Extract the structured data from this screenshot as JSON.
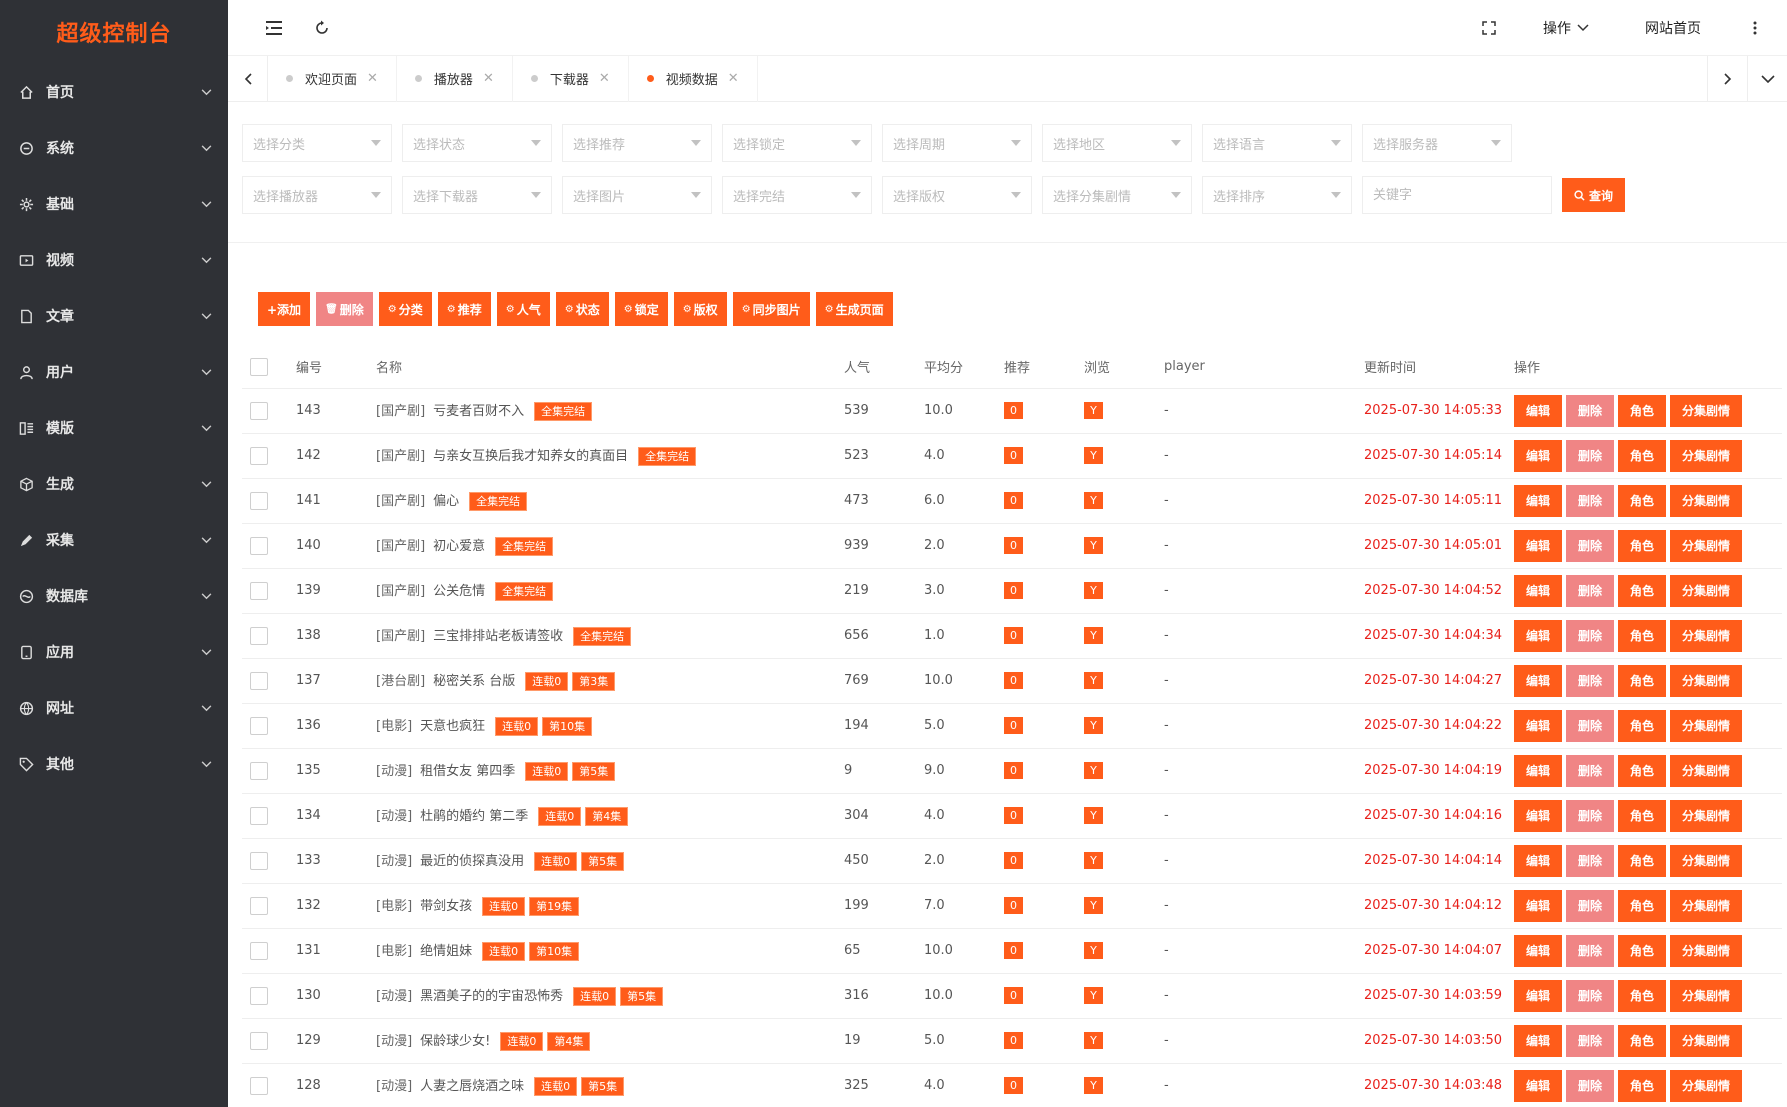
{
  "sidebar": {
    "title": "超级控制台",
    "items": [
      {
        "label": "首页",
        "icon": "home-icon"
      },
      {
        "label": "系统",
        "icon": "system-icon"
      },
      {
        "label": "基础",
        "icon": "gear-icon"
      },
      {
        "label": "视频",
        "icon": "video-icon"
      },
      {
        "label": "文章",
        "icon": "document-icon"
      },
      {
        "label": "用户",
        "icon": "user-icon"
      },
      {
        "label": "模版",
        "icon": "template-icon"
      },
      {
        "label": "生成",
        "icon": "cube-icon"
      },
      {
        "label": "采集",
        "icon": "pen-icon"
      },
      {
        "label": "数据库",
        "icon": "database-icon"
      },
      {
        "label": "应用",
        "icon": "tablet-icon"
      },
      {
        "label": "网址",
        "icon": "globe-icon"
      },
      {
        "label": "其他",
        "icon": "tag-icon"
      }
    ]
  },
  "header": {
    "operate": "操作",
    "site_home": "网站首页"
  },
  "tabs": [
    {
      "label": "欢迎页面",
      "active": false
    },
    {
      "label": "播放器",
      "active": false
    },
    {
      "label": "下载器",
      "active": false
    },
    {
      "label": "视频数据",
      "active": true
    }
  ],
  "filters": {
    "row1": [
      "选择分类",
      "选择状态",
      "选择推荐",
      "选择锁定",
      "选择周期",
      "选择地区",
      "选择语言",
      "选择服务器"
    ],
    "row2": [
      "选择播放器",
      "选择下载器",
      "选择图片",
      "选择完结",
      "选择版权",
      "选择分集剧情",
      "选择排序"
    ],
    "keyword_placeholder": "关键字",
    "query_label": "查询"
  },
  "toolbar": [
    {
      "label": "+添加",
      "style": "orange"
    },
    {
      "label": "删除",
      "style": "pink"
    },
    {
      "label": "分类",
      "style": "orange"
    },
    {
      "label": "推荐",
      "style": "orange"
    },
    {
      "label": "人气",
      "style": "orange"
    },
    {
      "label": "状态",
      "style": "orange"
    },
    {
      "label": "锁定",
      "style": "orange"
    },
    {
      "label": "版权",
      "style": "orange"
    },
    {
      "label": "同步图片",
      "style": "orange"
    },
    {
      "label": "生成页面",
      "style": "orange"
    }
  ],
  "table": {
    "columns": [
      "编号",
      "名称",
      "人气",
      "平均分",
      "推荐",
      "浏览",
      "player",
      "更新时间",
      "操作"
    ],
    "actions": [
      "编辑",
      "删除",
      "角色",
      "分集剧情"
    ],
    "rows": [
      {
        "id": "143",
        "cat": "[国产剧]",
        "name": "亏麦者百财不入",
        "tags": [
          "全集完结"
        ],
        "hits": "539",
        "score": "10.0",
        "rec": "0",
        "view": "Y",
        "player": "-",
        "time": "2025-07-30 14:05:33"
      },
      {
        "id": "142",
        "cat": "[国产剧]",
        "name": "与亲女互换后我才知养女的真面目",
        "tags": [
          "全集完结"
        ],
        "hits": "523",
        "score": "4.0",
        "rec": "0",
        "view": "Y",
        "player": "-",
        "time": "2025-07-30 14:05:14"
      },
      {
        "id": "141",
        "cat": "[国产剧]",
        "name": "偏心",
        "tags": [
          "全集完结"
        ],
        "hits": "473",
        "score": "6.0",
        "rec": "0",
        "view": "Y",
        "player": "-",
        "time": "2025-07-30 14:05:11"
      },
      {
        "id": "140",
        "cat": "[国产剧]",
        "name": "初心爱意",
        "tags": [
          "全集完结"
        ],
        "hits": "939",
        "score": "2.0",
        "rec": "0",
        "view": "Y",
        "player": "-",
        "time": "2025-07-30 14:05:01"
      },
      {
        "id": "139",
        "cat": "[国产剧]",
        "name": "公关危情",
        "tags": [
          "全集完结"
        ],
        "hits": "219",
        "score": "3.0",
        "rec": "0",
        "view": "Y",
        "player": "-",
        "time": "2025-07-30 14:04:52"
      },
      {
        "id": "138",
        "cat": "[国产剧]",
        "name": "三宝排排站老板请签收",
        "tags": [
          "全集完结"
        ],
        "hits": "656",
        "score": "1.0",
        "rec": "0",
        "view": "Y",
        "player": "-",
        "time": "2025-07-30 14:04:34"
      },
      {
        "id": "137",
        "cat": "[港台剧]",
        "name": "秘密关系 台版",
        "tags": [
          "连载0",
          "第3集"
        ],
        "hits": "769",
        "score": "10.0",
        "rec": "0",
        "view": "Y",
        "player": "-",
        "time": "2025-07-30 14:04:27"
      },
      {
        "id": "136",
        "cat": "[电影]",
        "name": "天意也疯狂",
        "tags": [
          "连载0",
          "第10集"
        ],
        "hits": "194",
        "score": "5.0",
        "rec": "0",
        "view": "Y",
        "player": "-",
        "time": "2025-07-30 14:04:22"
      },
      {
        "id": "135",
        "cat": "[动漫]",
        "name": "租借女友 第四季",
        "tags": [
          "连载0",
          "第5集"
        ],
        "hits": "9",
        "score": "9.0",
        "rec": "0",
        "view": "Y",
        "player": "-",
        "time": "2025-07-30 14:04:19"
      },
      {
        "id": "134",
        "cat": "[动漫]",
        "name": "杜鹃的婚约 第二季",
        "tags": [
          "连载0",
          "第4集"
        ],
        "hits": "304",
        "score": "4.0",
        "rec": "0",
        "view": "Y",
        "player": "-",
        "time": "2025-07-30 14:04:16"
      },
      {
        "id": "133",
        "cat": "[动漫]",
        "name": "最近的侦探真没用",
        "tags": [
          "连载0",
          "第5集"
        ],
        "hits": "450",
        "score": "2.0",
        "rec": "0",
        "view": "Y",
        "player": "-",
        "time": "2025-07-30 14:04:14"
      },
      {
        "id": "132",
        "cat": "[电影]",
        "name": "带剑女孩",
        "tags": [
          "连载0",
          "第19集"
        ],
        "hits": "199",
        "score": "7.0",
        "rec": "0",
        "view": "Y",
        "player": "-",
        "time": "2025-07-30 14:04:12"
      },
      {
        "id": "131",
        "cat": "[电影]",
        "name": "绝情姐妹",
        "tags": [
          "连载0",
          "第10集"
        ],
        "hits": "65",
        "score": "10.0",
        "rec": "0",
        "view": "Y",
        "player": "-",
        "time": "2025-07-30 14:04:07"
      },
      {
        "id": "130",
        "cat": "[动漫]",
        "name": "黑酒美子的的宇宙恐怖秀",
        "tags": [
          "连载0",
          "第5集"
        ],
        "hits": "316",
        "score": "10.0",
        "rec": "0",
        "view": "Y",
        "player": "-",
        "time": "2025-07-30 14:03:59"
      },
      {
        "id": "129",
        "cat": "[动漫]",
        "name": "保龄球少女!",
        "tags": [
          "连载0",
          "第4集"
        ],
        "hits": "19",
        "score": "5.0",
        "rec": "0",
        "view": "Y",
        "player": "-",
        "time": "2025-07-30 14:03:50"
      },
      {
        "id": "128",
        "cat": "[动漫]",
        "name": "人妻之唇烧酒之味",
        "tags": [
          "连载0",
          "第5集"
        ],
        "hits": "325",
        "score": "4.0",
        "rec": "0",
        "view": "Y",
        "player": "-",
        "time": "2025-07-30 14:03:48"
      }
    ]
  },
  "colors": {
    "accent": "#ff5c1a",
    "danger_soft": "#f08585",
    "sidebar_bg": "#2f3136",
    "time_red": "#e8211b"
  }
}
